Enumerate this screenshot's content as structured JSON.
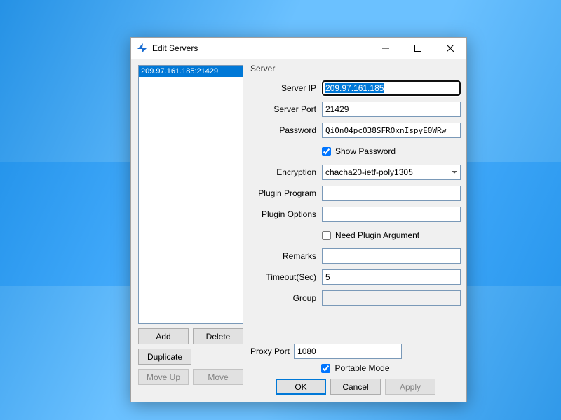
{
  "window": {
    "title": "Edit Servers"
  },
  "servers": {
    "items": [
      {
        "label": "209.97.161.185:21429",
        "selected": true
      }
    ]
  },
  "list_buttons": {
    "add": "Add",
    "delete": "Delete",
    "duplicate": "Duplicate",
    "move_up": "Move Up",
    "move": "Move"
  },
  "form": {
    "group_title": "Server",
    "server_ip": {
      "label": "Server IP",
      "value": "209.97.161.185"
    },
    "server_port": {
      "label": "Server Port",
      "value": "21429"
    },
    "password": {
      "label": "Password",
      "value": "Qi0n04pcO38SFROxnIspyE0WRw"
    },
    "show_password": {
      "label": "Show Password",
      "checked": true
    },
    "encryption": {
      "label": "Encryption",
      "value": "chacha20-ietf-poly1305"
    },
    "plugin_program": {
      "label": "Plugin Program",
      "value": ""
    },
    "plugin_options": {
      "label": "Plugin Options",
      "value": ""
    },
    "need_plugin_arg": {
      "label": "Need Plugin Argument",
      "checked": false
    },
    "remarks": {
      "label": "Remarks",
      "value": ""
    },
    "timeout": {
      "label": "Timeout(Sec)",
      "value": "5"
    },
    "group": {
      "label": "Group",
      "value": ""
    }
  },
  "footer": {
    "proxy_port": {
      "label": "Proxy Port",
      "value": "1080"
    },
    "portable_mode": {
      "label": "Portable Mode",
      "checked": true
    },
    "ok": "OK",
    "cancel": "Cancel",
    "apply": "Apply"
  }
}
